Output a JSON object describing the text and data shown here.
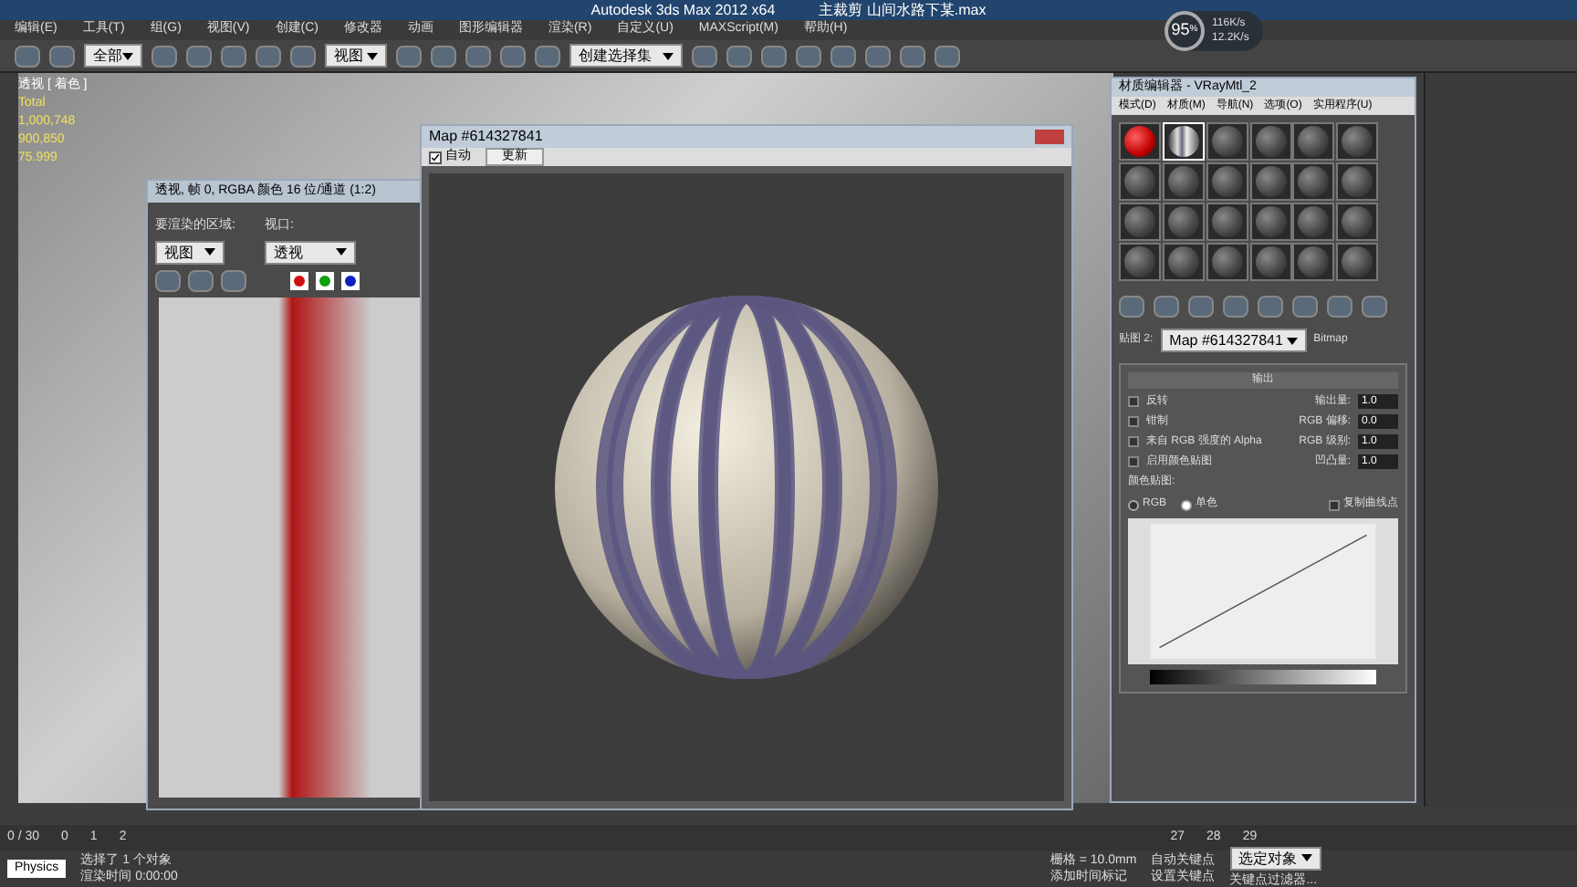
{
  "window": {
    "title": "Autodesk 3ds Max  2012 x64",
    "file": "主裁剪 山间水路下某.max"
  },
  "menu": [
    "编辑(E)",
    "工具(T)",
    "组(G)",
    "视图(V)",
    "创建(C)",
    "修改器",
    "动画",
    "图形编辑器",
    "渲染(R)",
    "自定义(U)",
    "MAXScript(M)",
    "帮助(H)"
  ],
  "toolbar": {
    "filter": "全部",
    "coord": "视图",
    "selection_set": "创建选择集"
  },
  "net_overlay": {
    "percent": "95",
    "unit": "%",
    "up": "116K/s",
    "down": "12.2K/s"
  },
  "viewport": {
    "label": "透视 [ 着色 ]",
    "stats": [
      "Total",
      "1,000,748",
      "900,850",
      "75.999"
    ]
  },
  "render_window": {
    "title": "透视, 帧 0, RGBA 颜色 16 位/通道 (1:2)",
    "area_label": "要渲染的区域:",
    "area_value": "视图",
    "viewport_label": "视口:",
    "viewport_value": "透视",
    "channels": [
      {
        "color": "#d01010",
        "on": true
      },
      {
        "color": "#10a010",
        "on": true
      },
      {
        "color": "#1020c0",
        "on": true
      }
    ]
  },
  "map_window": {
    "title": "Map #614327841",
    "auto": {
      "label": "自动",
      "checked": true
    },
    "update": "更新"
  },
  "material_editor": {
    "title": "材质编辑器 - VRayMtl_2",
    "menu": [
      "模式(D)",
      "材质(M)",
      "导航(N)",
      "选项(O)",
      "实用程序(U)"
    ],
    "slots": [
      {
        "kind": "red",
        "selected": false
      },
      {
        "kind": "striped",
        "selected": true
      },
      {
        "kind": "empty",
        "selected": false
      },
      {
        "kind": "empty",
        "selected": false
      },
      {
        "kind": "empty",
        "selected": false
      },
      {
        "kind": "empty",
        "selected": false
      },
      {
        "kind": "empty",
        "selected": false
      },
      {
        "kind": "empty",
        "selected": false
      },
      {
        "kind": "empty",
        "selected": false
      },
      {
        "kind": "empty",
        "selected": false
      },
      {
        "kind": "empty",
        "selected": false
      },
      {
        "kind": "empty",
        "selected": false
      },
      {
        "kind": "empty",
        "selected": false
      },
      {
        "kind": "empty",
        "selected": false
      },
      {
        "kind": "empty",
        "selected": false
      },
      {
        "kind": "empty",
        "selected": false
      },
      {
        "kind": "empty",
        "selected": false
      },
      {
        "kind": "empty",
        "selected": false
      },
      {
        "kind": "empty",
        "selected": false
      },
      {
        "kind": "empty",
        "selected": false
      },
      {
        "kind": "empty",
        "selected": false
      },
      {
        "kind": "empty",
        "selected": false
      },
      {
        "kind": "empty",
        "selected": false
      },
      {
        "kind": "empty",
        "selected": false
      }
    ],
    "map_label": "贴图 2:",
    "map_name": "Map #614327841",
    "map_type": "Bitmap",
    "rollout": "输出",
    "options": [
      {
        "label": "反转",
        "checked": false
      },
      {
        "label": "钳制",
        "checked": false
      },
      {
        "label": "来自 RGB 强度的 Alpha",
        "checked": false
      },
      {
        "label": "启用颜色贴图",
        "checked": false
      }
    ],
    "spinners": [
      {
        "label": "输出量:",
        "value": "1.0"
      },
      {
        "label": "RGB 偏移:",
        "value": "0.0"
      },
      {
        "label": "RGB 级别:",
        "value": "1.0"
      },
      {
        "label": "凹凸量:",
        "value": "1.0"
      }
    ],
    "color_map": {
      "label": "颜色贴图:",
      "modes": [
        {
          "label": "RGB",
          "selected": false
        },
        {
          "label": "单色",
          "selected": true
        }
      ],
      "copy_points": {
        "label": "复制曲线点",
        "checked": false
      }
    }
  },
  "timeline": {
    "frame": "0 / 30",
    "ticks": [
      "0",
      "1",
      "2",
      "27",
      "28",
      "29"
    ]
  },
  "status": {
    "physics": "Physics",
    "selected": "选择了 1 个对象",
    "render_time": "渲染时间 0:00:00",
    "grid": "栅格 = 10.0mm",
    "add_tag": "添加时间标记",
    "auto_key": "自动关键点",
    "key_mode": "选定对象",
    "set_key": "设置关键点",
    "key_filter": "关键点过滤器..."
  }
}
